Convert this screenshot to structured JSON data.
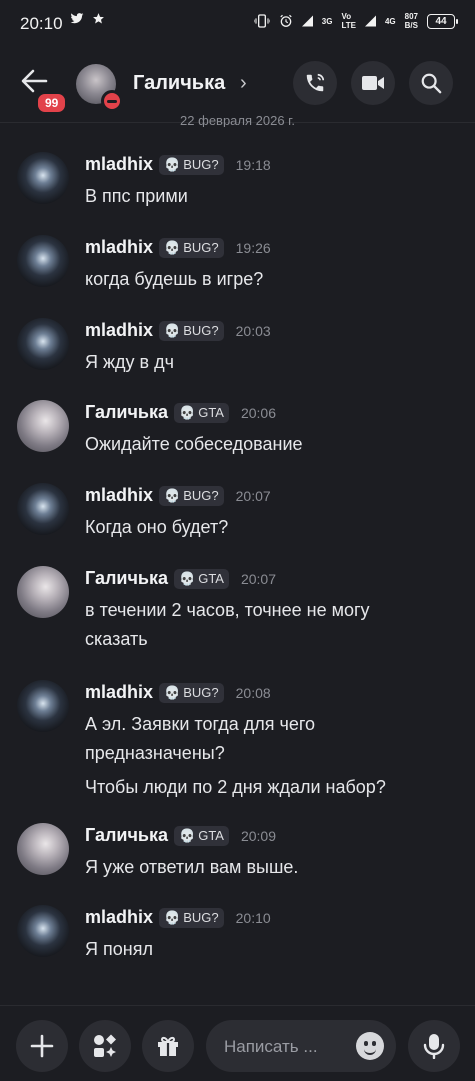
{
  "status_bar": {
    "time": "20:10",
    "left_icons": [
      "twitter-icon",
      "star-icon"
    ],
    "net1": "3G",
    "net2_top": "Vo",
    "net2_bottom": "LTE",
    "net3": "4G",
    "speed_top": "807",
    "speed_bottom": "B/S",
    "battery": "44"
  },
  "header": {
    "back_badge": "99",
    "name": "Галичька",
    "chevron": "›",
    "buttons": [
      "phone-icon",
      "video-icon",
      "search-icon"
    ]
  },
  "date_separator": "22 февраля 2026 г.",
  "messages": [
    {
      "author": "mladhix",
      "tag_icon": "💀",
      "tag": "BUG?",
      "time": "19:18",
      "lines": [
        "В ппс прими"
      ]
    },
    {
      "author": "mladhix",
      "tag_icon": "💀",
      "tag": "BUG?",
      "time": "19:26",
      "lines": [
        "когда будешь в игре?"
      ]
    },
    {
      "author": "mladhix",
      "tag_icon": "💀",
      "tag": "BUG?",
      "time": "20:03",
      "lines": [
        "Я жду в дч"
      ]
    },
    {
      "author": "Галичька",
      "tag_icon": "💀",
      "tag": "GTA",
      "time": "20:06",
      "lines": [
        "Ожидайте собеседование"
      ]
    },
    {
      "author": "mladhix",
      "tag_icon": "💀",
      "tag": "BUG?",
      "time": "20:07",
      "lines": [
        "Когда оно будет?"
      ]
    },
    {
      "author": "Галичька",
      "tag_icon": "💀",
      "tag": "GTA",
      "time": "20:07",
      "lines": [
        "в течении 2 часов, точнее не могу",
        "сказать"
      ]
    },
    {
      "author": "mladhix",
      "tag_icon": "💀",
      "tag": "BUG?",
      "time": "20:08",
      "lines": [
        "А эл. Заявки тогда для чего",
        "предназначены?",
        "Чтобы люди по 2 дня ждали набор?"
      ]
    },
    {
      "author": "Галичька",
      "tag_icon": "💀",
      "tag": "GTA",
      "time": "20:09",
      "lines": [
        "Я уже ответил вам выше."
      ]
    },
    {
      "author": "mladhix",
      "tag_icon": "💀",
      "tag": "BUG?",
      "time": "20:10",
      "lines": [
        "Я понял"
      ]
    }
  ],
  "composer": {
    "placeholder": "Написать ...",
    "buttons": [
      "plus-icon",
      "apps-icon",
      "gift-icon",
      "microphone-icon"
    ]
  },
  "colors": {
    "background": "#1c1d22",
    "button_bg": "#2c2d33",
    "badge_red": "#e2424a",
    "tag_bug_icon": "#b77cf0",
    "tag_gta_icon": "#c8c8c8"
  }
}
